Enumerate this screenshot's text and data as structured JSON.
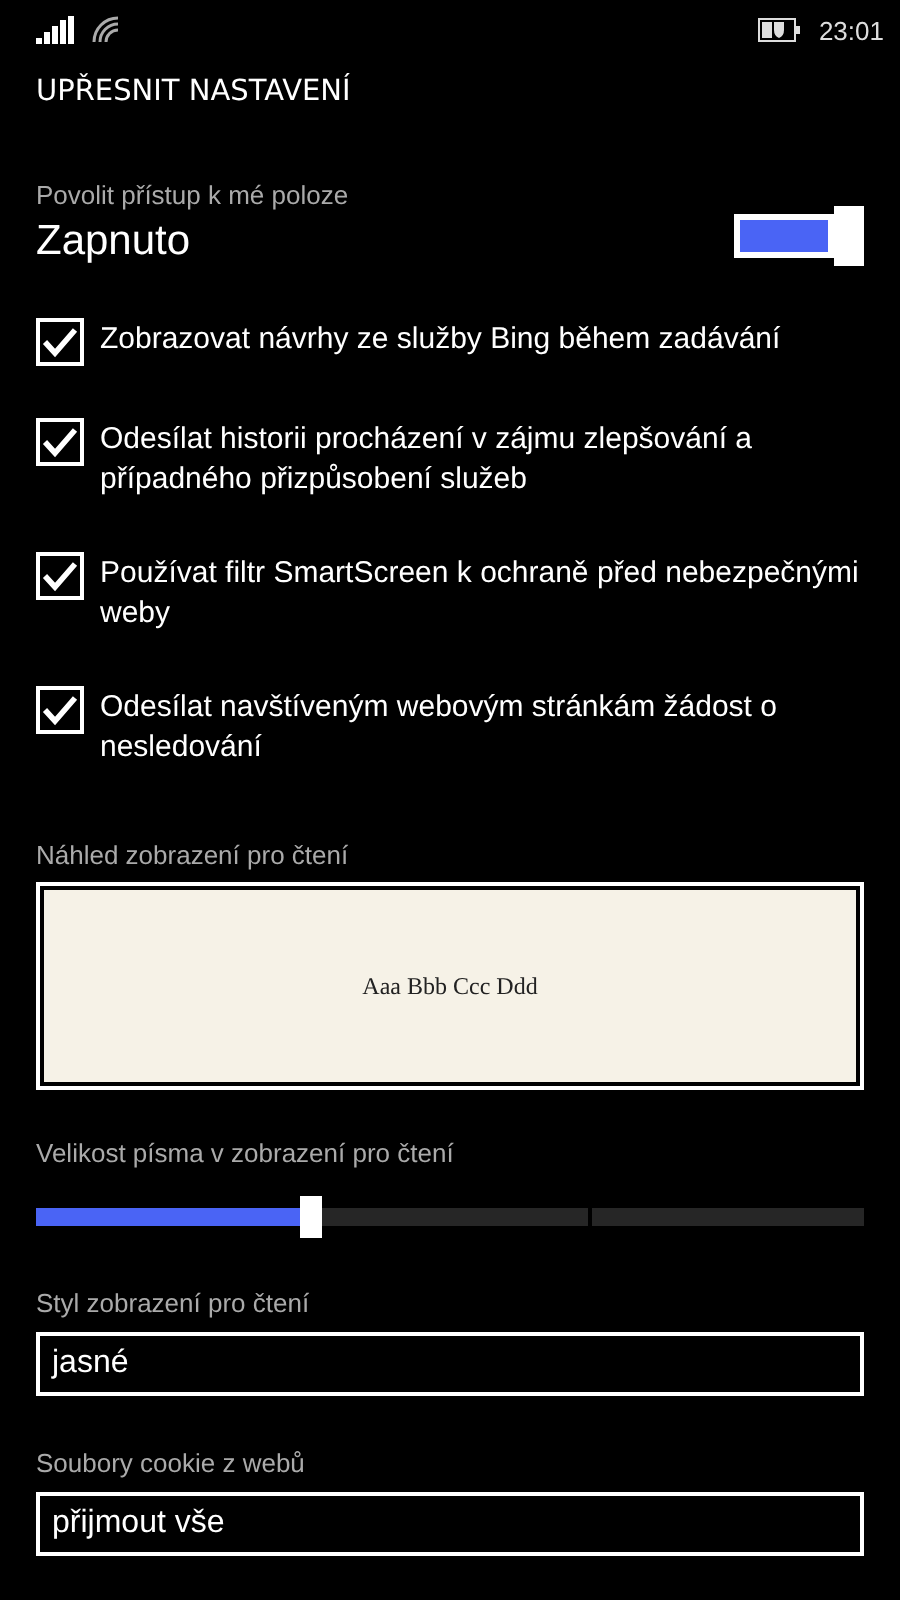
{
  "status_bar": {
    "time": "23:01"
  },
  "title": "UPŘESNIT NASTAVENÍ",
  "location": {
    "label": "Povolit přístup k mé poloze",
    "value": "Zapnuto",
    "on": true
  },
  "options": [
    {
      "label": "Zobrazovat návrhy ze služby Bing během zadávání",
      "checked": true
    },
    {
      "label": "Odesílat historii procházení v zájmu zlepšování a případného přizpůsobení služeb",
      "checked": true
    },
    {
      "label": "Používat filtr SmartScreen k ochraně před nebezpečnými weby",
      "checked": true
    },
    {
      "label": "Odesílat navštíveným webovým stránkám žádost o nesledování",
      "checked": true
    }
  ],
  "preview": {
    "label": "Náhled zobrazení pro čtení",
    "sample": "Aaa Bbb Ccc Ddd"
  },
  "font_size": {
    "label": "Velikost písma v zobrazení pro čtení",
    "level": 0.33
  },
  "fields": [
    {
      "label": "Styl zobrazení pro čtení",
      "value": "jasné"
    },
    {
      "label": "Soubory cookie z webů",
      "value": "přijmout vše"
    }
  ]
}
